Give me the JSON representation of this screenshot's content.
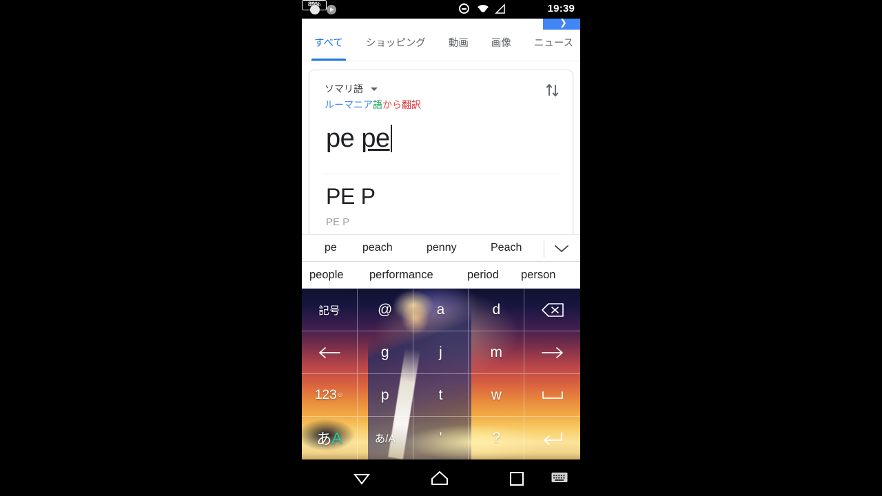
{
  "status_bar": {
    "notifications": [
      "circle-notification",
      "play-notification"
    ],
    "dnd_icon": "do-not-disturb-icon",
    "wifi_icon": "wifi-icon",
    "signal_icon": "cell-signal-icon",
    "battery_text": "89%",
    "time": "19:39"
  },
  "search": {
    "button_icon": "search-submit-icon",
    "button_color": "#4285f4"
  },
  "tabs": [
    {
      "label": "すべて",
      "active": true
    },
    {
      "label": "ショッピング",
      "active": false
    },
    {
      "label": "動画",
      "active": false
    },
    {
      "label": "画像",
      "active": false
    },
    {
      "label": "ニュース",
      "active": false
    }
  ],
  "translate_card": {
    "language_name": "ソマリ語",
    "language_caret_icon": "chevron-down-icon",
    "swap_icon": "swap-vertical-icon",
    "translate_from": {
      "part1": "ルーマニア",
      "part2": "語",
      "part3": "から",
      "part4": "翻訳",
      "full": "ルーマニア語から翻訳"
    },
    "source_text_committed": "pe ",
    "source_text_composing": "pe",
    "result_text": "PE P",
    "transliteration": "PE P"
  },
  "suggestion_row_1": {
    "items": [
      "pe",
      "peach",
      "penny",
      "Peach"
    ],
    "expand_icon": "chevron-down-icon"
  },
  "suggestion_row_2": {
    "items": [
      "people",
      "performance",
      "period",
      "person"
    ]
  },
  "keyboard": {
    "keys": [
      {
        "label": "記号",
        "name": "key-symbols",
        "type": "text-small"
      },
      {
        "label": "@",
        "name": "key-at",
        "type": "text"
      },
      {
        "label": "a",
        "name": "key-a",
        "type": "text"
      },
      {
        "label": "d",
        "name": "key-d",
        "type": "text"
      },
      {
        "label": "",
        "name": "key-backspace",
        "type": "icon-backspace"
      },
      {
        "label": "",
        "name": "key-arrow-left",
        "type": "icon-arrow-left"
      },
      {
        "label": "g",
        "name": "key-g",
        "type": "text"
      },
      {
        "label": "j",
        "name": "key-j",
        "type": "text"
      },
      {
        "label": "m",
        "name": "key-m",
        "type": "text"
      },
      {
        "label": "",
        "name": "key-arrow-right",
        "type": "icon-arrow-right"
      },
      {
        "label": "123",
        "name": "key-numbers",
        "type": "text-numbers"
      },
      {
        "label": "p",
        "name": "key-p",
        "type": "text"
      },
      {
        "label": "t",
        "name": "key-t",
        "type": "text"
      },
      {
        "label": "w",
        "name": "key-w",
        "type": "text"
      },
      {
        "label": "",
        "name": "key-space",
        "type": "icon-space"
      },
      {
        "label": "あA",
        "name": "key-language-toggle",
        "type": "text-lang"
      },
      {
        "label": "あ/A",
        "name": "key-kana-alpha",
        "type": "text-small"
      },
      {
        "label": "'",
        "name": "key-apostrophe",
        "type": "text"
      },
      {
        "label": "?",
        "name": "key-question",
        "type": "text"
      },
      {
        "label": "",
        "name": "key-enter",
        "type": "icon-enter"
      }
    ]
  },
  "nav_bar": {
    "back_icon": "back-down-triangle-icon",
    "home_icon": "home-icon",
    "recents_icon": "recents-square-icon",
    "keyboard_icon": "keyboard-switch-icon"
  }
}
